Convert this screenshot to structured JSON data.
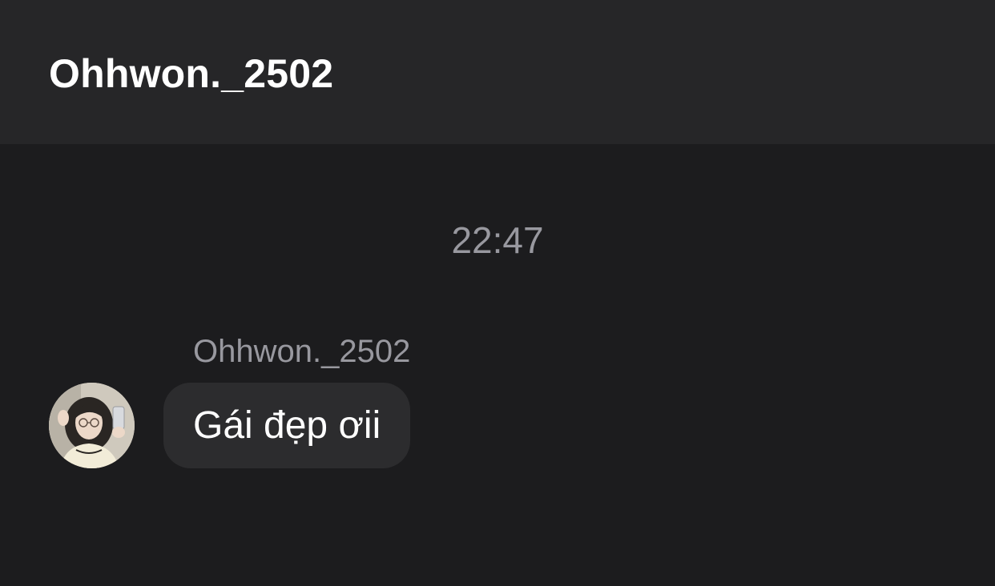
{
  "header": {
    "title": "Ohhwon._2502"
  },
  "thread": {
    "timestamp": "22:47",
    "messages": [
      {
        "sender": "Ohhwon._2502",
        "text": "Gái đẹp ơii",
        "avatar_icon": "user-avatar-photo"
      }
    ]
  },
  "colors": {
    "background": "#1c1c1e",
    "header_background": "#262628",
    "bubble_background": "#2c2c2e",
    "secondary_text": "#98989f",
    "primary_text": "#ffffff"
  }
}
